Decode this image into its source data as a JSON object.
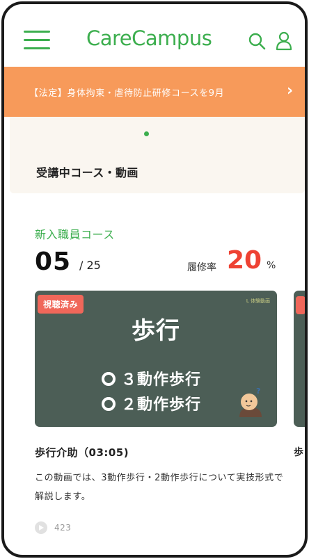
{
  "header": {
    "logo": "CareCampus",
    "menu_icon": "hamburger-menu-icon",
    "search_icon": "search-icon",
    "user_icon": "user-icon",
    "accent_color": "#3cae4e"
  },
  "notice": {
    "text": "【法定】身体拘束・虐待防止研修コースを9月",
    "chevron": "›",
    "color": "#f79a5a"
  },
  "progress_section": {
    "title": "受講中コース・動画"
  },
  "course": {
    "title": "新入職員コース",
    "current": "05",
    "total": "/ 25",
    "rate_label": "履修率",
    "rate_value": "20",
    "rate_unit": "%",
    "rate_color": "#ee4233"
  },
  "video": {
    "badge": "視聴済み",
    "brand": "L 体験動画",
    "thumb_title": "歩行",
    "thumb_items": [
      "３動作歩行",
      "２動作歩行"
    ],
    "title": "歩行介助（03:05)",
    "description": "この動画では、3動作歩行・2動作歩行について実技形式で解説します。",
    "views": "423"
  },
  "next_video": {
    "label_partial": "歩"
  }
}
